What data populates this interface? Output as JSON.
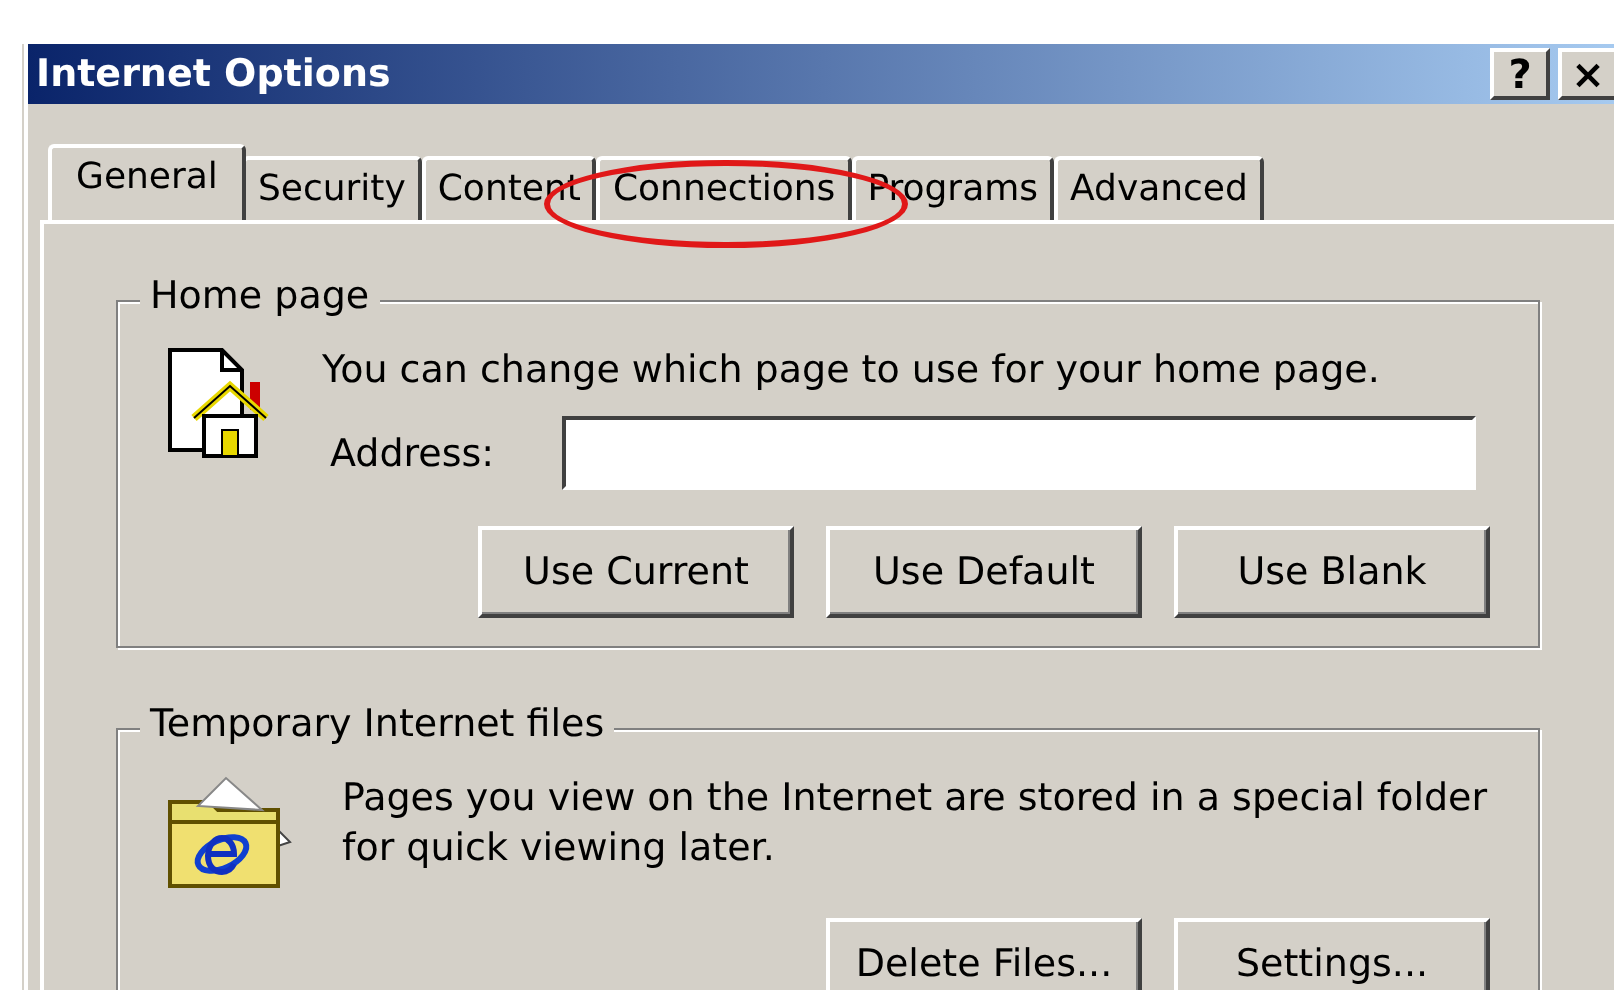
{
  "window": {
    "title": "Internet Options",
    "title_buttons": [
      "?",
      "×"
    ]
  },
  "tabs": [
    {
      "label": "General",
      "selected": true,
      "circled": false
    },
    {
      "label": "Security",
      "selected": false,
      "circled": false
    },
    {
      "label": "Content",
      "selected": false,
      "circled": false
    },
    {
      "label": "Connections",
      "selected": false,
      "circled": true
    },
    {
      "label": "Programs",
      "selected": false,
      "circled": false
    },
    {
      "label": "Advanced",
      "selected": false,
      "circled": false
    }
  ],
  "groups": [
    {
      "kind": "home",
      "title": "Home page",
      "text": "You can change which page to use for your home page.",
      "address": {
        "label": "Address:"
      },
      "buttons": [
        "Use Current",
        "Use Default",
        "Use Blank"
      ]
    },
    {
      "kind": "cache",
      "title": "Temporary Internet files",
      "text": "Pages you view on the Internet are stored in a special folder for quick viewing later.",
      "buttons": [
        "Delete Files...",
        "Settings..."
      ]
    }
  ]
}
